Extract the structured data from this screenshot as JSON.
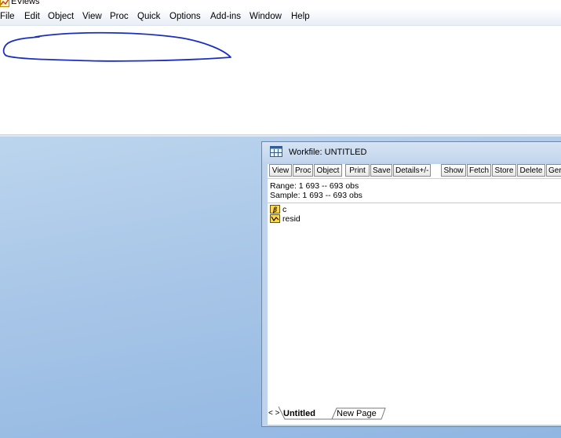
{
  "app": {
    "title": "EViews",
    "icon": "eviews-app-icon"
  },
  "menubar": {
    "items": [
      "File",
      "Edit",
      "Object",
      "View",
      "Proc",
      "Quick",
      "Options",
      "Add-ins",
      "Window",
      "Help"
    ]
  },
  "colors": {
    "desktop": "#a7c5e7",
    "scribble": "#1a2fc0",
    "window_frame": "#bfd4ec"
  },
  "workfile": {
    "title": "Workfile: UNTITLED",
    "toolbar": {
      "view": "View",
      "proc": "Proc",
      "object": "Object",
      "print": "Print",
      "save": "Save",
      "details": "Details+/-",
      "show": "Show",
      "fetch": "Fetch",
      "store": "Store",
      "delete": "Delete",
      "genr": "Ger"
    },
    "range": "Range:  1 693  --  693 obs",
    "sample": "Sample: 1 693  --  693 obs",
    "objects": [
      {
        "name": "c",
        "icon": "coefficient-beta-icon"
      },
      {
        "name": "resid",
        "icon": "series-icon"
      }
    ],
    "tabs": {
      "nav": "< >",
      "active": "Untitled",
      "new": "New Page"
    }
  }
}
